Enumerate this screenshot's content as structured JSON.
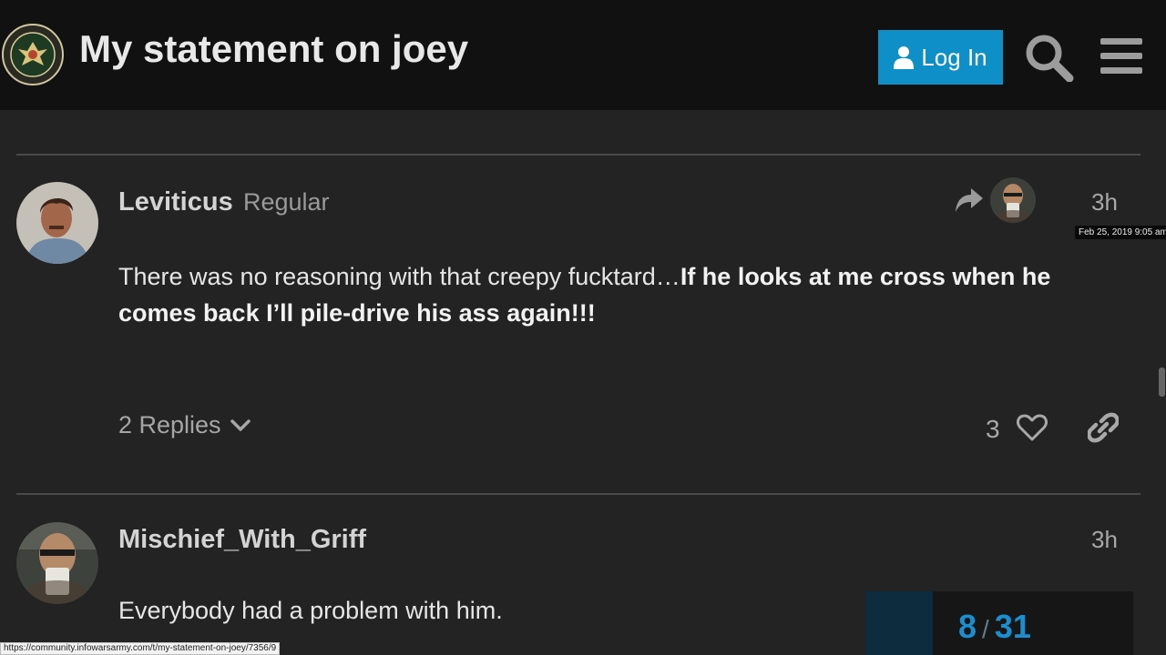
{
  "header": {
    "title": "My statement on joey",
    "login_label": "Log In",
    "logo_icon": "infowars-army-seal-icon",
    "search_icon": "search-icon",
    "menu_icon": "hamburger-menu-icon",
    "accent_color": "#0e8fc8"
  },
  "posts": [
    {
      "username": "Leviticus",
      "user_title": "Regular",
      "time": "3h",
      "time_tooltip": "Feb 25, 2019 9:05 am",
      "body_plain": "There was no reasoning with that creepy fucktard…",
      "body_bold": "If he looks at me cross when he comes back I’ll pile-drive his ass again!!!",
      "replies_label": "2 Replies",
      "like_count": "3"
    },
    {
      "username": "Mischief_With_Griff",
      "time": "3h",
      "body_plain": "Everybody had a problem with him."
    }
  ],
  "timeline": {
    "current": "8",
    "separator": "/",
    "total": "31"
  },
  "status_bar": {
    "url": "https://community.infowarsarmy.com/t/my-statement-on-joey/7356/9"
  }
}
